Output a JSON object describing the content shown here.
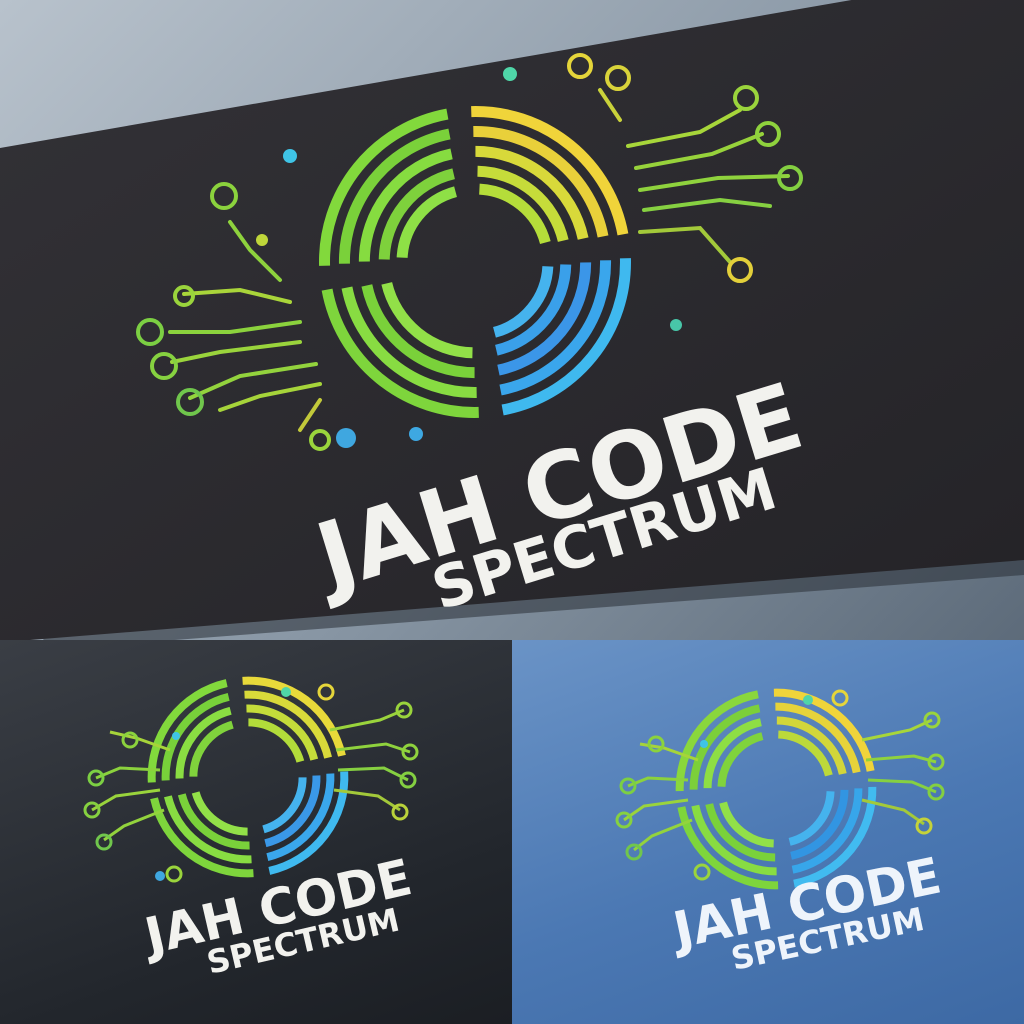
{
  "brand": {
    "name": "JAH CODE",
    "tagline": "SPECTRUM"
  },
  "colors": {
    "green": "#7bd63a",
    "lime": "#b7e23a",
    "yellow": "#f2d53a",
    "cyan": "#3fb8f0",
    "blue": "#3a8fe6",
    "card": "#2b2a2e",
    "text": "#f2f2ee"
  },
  "mockups": [
    {
      "name": "card-mockup",
      "background": "dark-card"
    },
    {
      "name": "dark-panel-mockup",
      "background": "charcoal"
    },
    {
      "name": "blue-panel-mockup",
      "background": "blue"
    }
  ]
}
